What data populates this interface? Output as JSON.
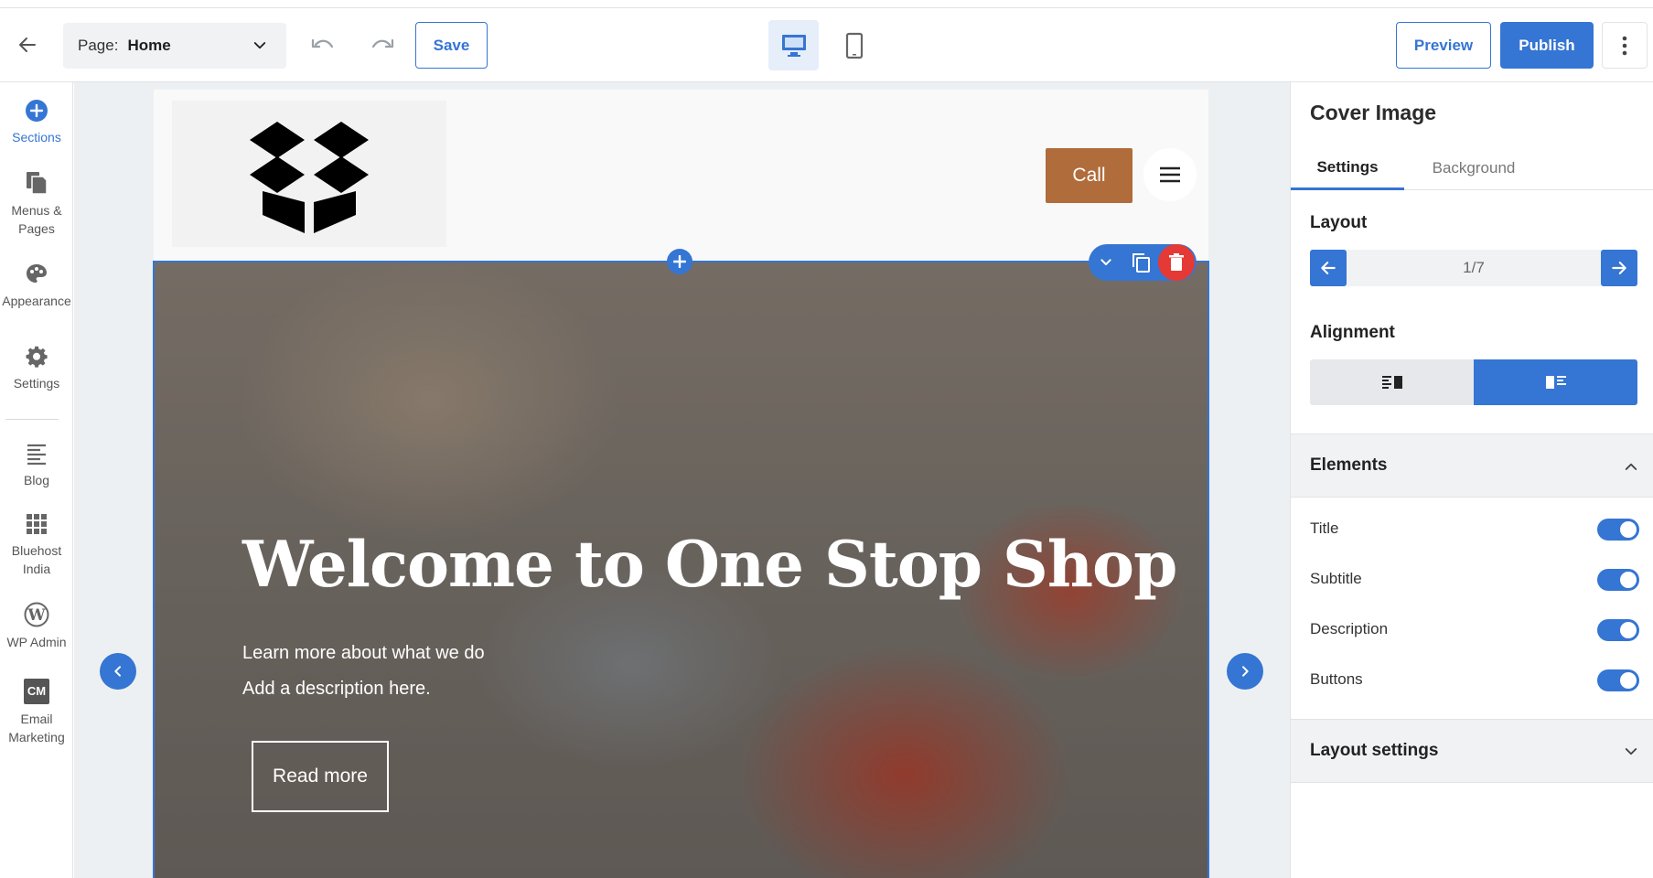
{
  "toolbar": {
    "page_label": "Page:",
    "page_value": "Home",
    "save_label": "Save",
    "preview_label": "Preview",
    "publish_label": "Publish"
  },
  "sidebar": {
    "items": [
      {
        "label": "Sections",
        "icon": "plus-circle-icon",
        "active": true
      },
      {
        "label": "Menus & Pages",
        "icon": "pages-icon"
      },
      {
        "label": "Appearance",
        "icon": "palette-icon"
      },
      {
        "label": "Settings",
        "icon": "gear-icon"
      },
      {
        "label": "Blog",
        "icon": "blog-icon"
      },
      {
        "label": "Bluehost India",
        "icon": "grid-icon"
      },
      {
        "label": "WP Admin",
        "icon": "wordpress-icon"
      },
      {
        "label": "Email Marketing",
        "icon": "cm-icon",
        "badge": "CM"
      }
    ]
  },
  "site": {
    "call_label": "Call",
    "hero": {
      "title": "Welcome to One Stop Shop",
      "subtitle": "Learn more about what we do",
      "description": "Add a description here.",
      "button_label": "Read more"
    }
  },
  "panel": {
    "title": "Cover Image",
    "tabs": [
      "Settings",
      "Background"
    ],
    "layout_label": "Layout",
    "layout_value": "1/7",
    "alignment_label": "Alignment",
    "elements_label": "Elements",
    "element_toggles": [
      {
        "label": "Title",
        "on": true
      },
      {
        "label": "Subtitle",
        "on": true
      },
      {
        "label": "Description",
        "on": true
      },
      {
        "label": "Buttons",
        "on": true
      }
    ],
    "layout_settings_label": "Layout settings"
  },
  "colors": {
    "accent": "#3575d3",
    "call_button": "#b06c3a",
    "delete": "#e53935"
  }
}
